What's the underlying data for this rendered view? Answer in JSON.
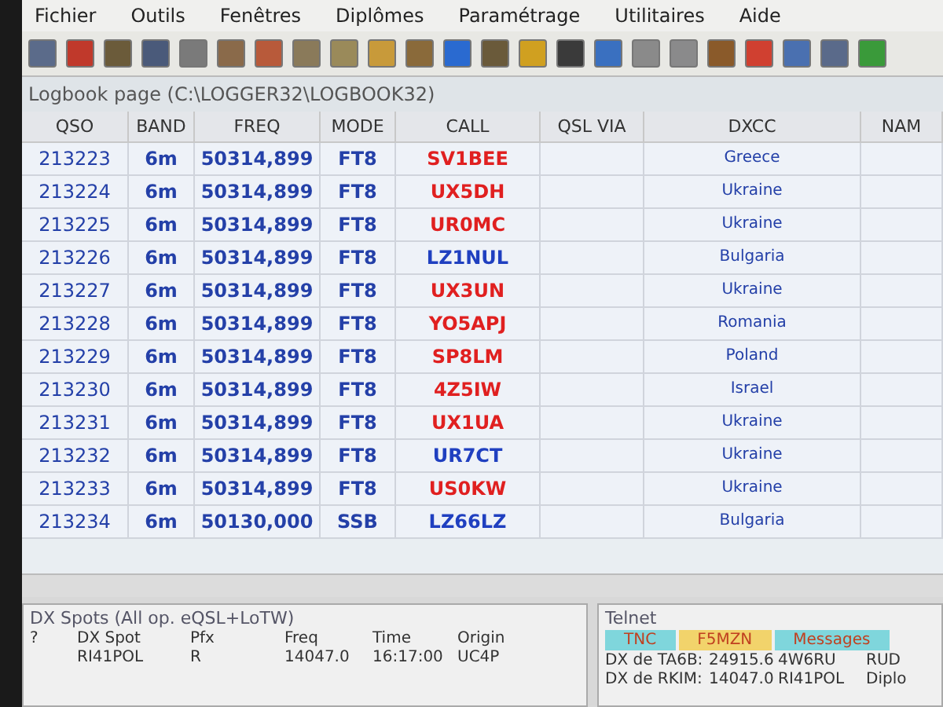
{
  "menu": [
    "Fichier",
    "Outils",
    "Fenêtres",
    "Diplômes",
    "Paramétrage",
    "Utilitaires",
    "Aide"
  ],
  "toolbar": {
    "buttons": [
      {
        "color": "#5b6b8a"
      },
      {
        "color": "#c0392b"
      },
      {
        "color": "#6b5b3a"
      },
      {
        "color": "#4a5a7a"
      },
      {
        "color": "#7a7a7a"
      },
      {
        "color": "#8a6a4a"
      },
      {
        "color": "#b85a3a"
      },
      {
        "color": "#8a7a5a"
      },
      {
        "color": "#9a8a5a"
      },
      {
        "color": "#c89a3a"
      },
      {
        "color": "#8a6a3a"
      },
      {
        "color": "#2a6ad0"
      },
      {
        "color": "#6a5a3a"
      },
      {
        "color": "#d0a020"
      },
      {
        "color": "#3a3a3a"
      },
      {
        "color": "#3a70c0"
      },
      {
        "color": "#8a8a8a"
      },
      {
        "color": "#8a8a8b"
      },
      {
        "color": "#8a5a2a"
      },
      {
        "color": "#d04030"
      },
      {
        "color": "#4a70b0"
      },
      {
        "color": "#5a6a8a"
      },
      {
        "color": "#3a9a3a"
      }
    ]
  },
  "logbook": {
    "title": "Logbook page (C:\\LOGGER32\\LOGBOOK32)",
    "columns": [
      "QSO",
      "BAND",
      "FREQ",
      "MODE",
      "CALL",
      "QSL VIA",
      "DXCC",
      "NAM"
    ],
    "rows": [
      {
        "qso": "213223",
        "band": "6m",
        "freq": "50314,899",
        "mode": "FT8",
        "call": "SV1BEE",
        "color": "#e02020",
        "dxcc": "Greece"
      },
      {
        "qso": "213224",
        "band": "6m",
        "freq": "50314,899",
        "mode": "FT8",
        "call": "UX5DH",
        "color": "#e02020",
        "dxcc": "Ukraine"
      },
      {
        "qso": "213225",
        "band": "6m",
        "freq": "50314,899",
        "mode": "FT8",
        "call": "UR0MC",
        "color": "#e02020",
        "dxcc": "Ukraine"
      },
      {
        "qso": "213226",
        "band": "6m",
        "freq": "50314,899",
        "mode": "FT8",
        "call": "LZ1NUL",
        "color": "#2040c0",
        "dxcc": "Bulgaria"
      },
      {
        "qso": "213227",
        "band": "6m",
        "freq": "50314,899",
        "mode": "FT8",
        "call": "UX3UN",
        "color": "#e02020",
        "dxcc": "Ukraine"
      },
      {
        "qso": "213228",
        "band": "6m",
        "freq": "50314,899",
        "mode": "FT8",
        "call": "YO5APJ",
        "color": "#e02020",
        "dxcc": "Romania"
      },
      {
        "qso": "213229",
        "band": "6m",
        "freq": "50314,899",
        "mode": "FT8",
        "call": "SP8LM",
        "color": "#e02020",
        "dxcc": "Poland"
      },
      {
        "qso": "213230",
        "band": "6m",
        "freq": "50314,899",
        "mode": "FT8",
        "call": "4Z5IW",
        "color": "#e02020",
        "dxcc": "Israel"
      },
      {
        "qso": "213231",
        "band": "6m",
        "freq": "50314,899",
        "mode": "FT8",
        "call": "UX1UA",
        "color": "#e02020",
        "dxcc": "Ukraine"
      },
      {
        "qso": "213232",
        "band": "6m",
        "freq": "50314,899",
        "mode": "FT8",
        "call": "UR7CT",
        "color": "#2040c0",
        "dxcc": "Ukraine"
      },
      {
        "qso": "213233",
        "band": "6m",
        "freq": "50314,899",
        "mode": "FT8",
        "call": "US0KW",
        "color": "#e02020",
        "dxcc": "Ukraine"
      },
      {
        "qso": "213234",
        "band": "6m",
        "freq": "50130,000",
        "mode": "SSB",
        "call": "LZ66LZ",
        "color": "#2040c0",
        "dxcc": "Bulgaria"
      }
    ]
  },
  "dx_spots": {
    "title": "DX Spots (All op. eQSL+LoTW)",
    "columns": [
      "?",
      "DX Spot",
      "Pfx",
      "Freq",
      "Time",
      "Origin"
    ],
    "rows": [
      {
        "cells": [
          "",
          "RI41POL",
          "R",
          "14047.0",
          "16:17:00",
          "UC4P"
        ]
      }
    ]
  },
  "telnet": {
    "title": "Telnet",
    "tabs": [
      {
        "label": "TNC",
        "color": "#7fd6dc"
      },
      {
        "label": "F5MZN",
        "color": "#f2d36b"
      },
      {
        "label": "Messages",
        "color": "#7fd6dc"
      }
    ],
    "rows": [
      {
        "cells": [
          "DX de TA6B:",
          "24915.6",
          "4W6RU",
          "RUD"
        ]
      },
      {
        "cells": [
          "DX de RKIM:",
          "14047.0",
          "RI41POL",
          "Diplo"
        ]
      }
    ]
  }
}
